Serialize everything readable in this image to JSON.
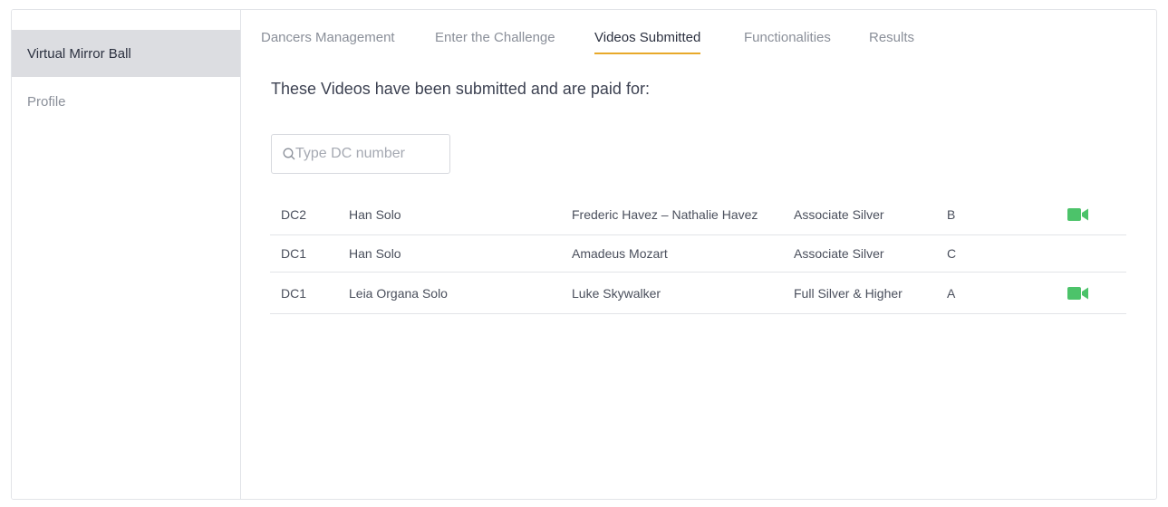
{
  "sidebar": {
    "items": [
      {
        "label": "Virtual Mirror Ball",
        "active": true
      },
      {
        "label": "Profile",
        "active": false
      }
    ]
  },
  "tabs": [
    {
      "label": "Dancers Management",
      "active": false
    },
    {
      "label": "Enter the Challenge",
      "active": false
    },
    {
      "label": "Videos Submitted",
      "active": true
    },
    {
      "label": "Functionalities",
      "active": false
    },
    {
      "label": "Results",
      "active": false
    }
  ],
  "main": {
    "heading": "These Videos have been submitted and are paid for:",
    "search": {
      "value": "",
      "placeholder": "Type DC number",
      "icon": "search-icon"
    }
  },
  "table": {
    "rows": [
      {
        "dc": "DC2",
        "leader": "Han Solo",
        "partner": "Frederic Havez – Nathalie Havez",
        "level": "Associate Silver",
        "grade": "B",
        "has_video": true
      },
      {
        "dc": "DC1",
        "leader": "Han Solo",
        "partner": "Amadeus Mozart",
        "level": "Associate Silver",
        "grade": "C",
        "has_video": false
      },
      {
        "dc": "DC1",
        "leader": "Leia Organa Solo",
        "partner": "Luke Skywalker",
        "level": "Full Silver & Higher",
        "grade": "A",
        "has_video": true
      }
    ]
  },
  "colors": {
    "accent_underline": "#e8a92a",
    "video_icon": "#4cc36a",
    "sidebar_active_bg": "#dcdde1"
  }
}
